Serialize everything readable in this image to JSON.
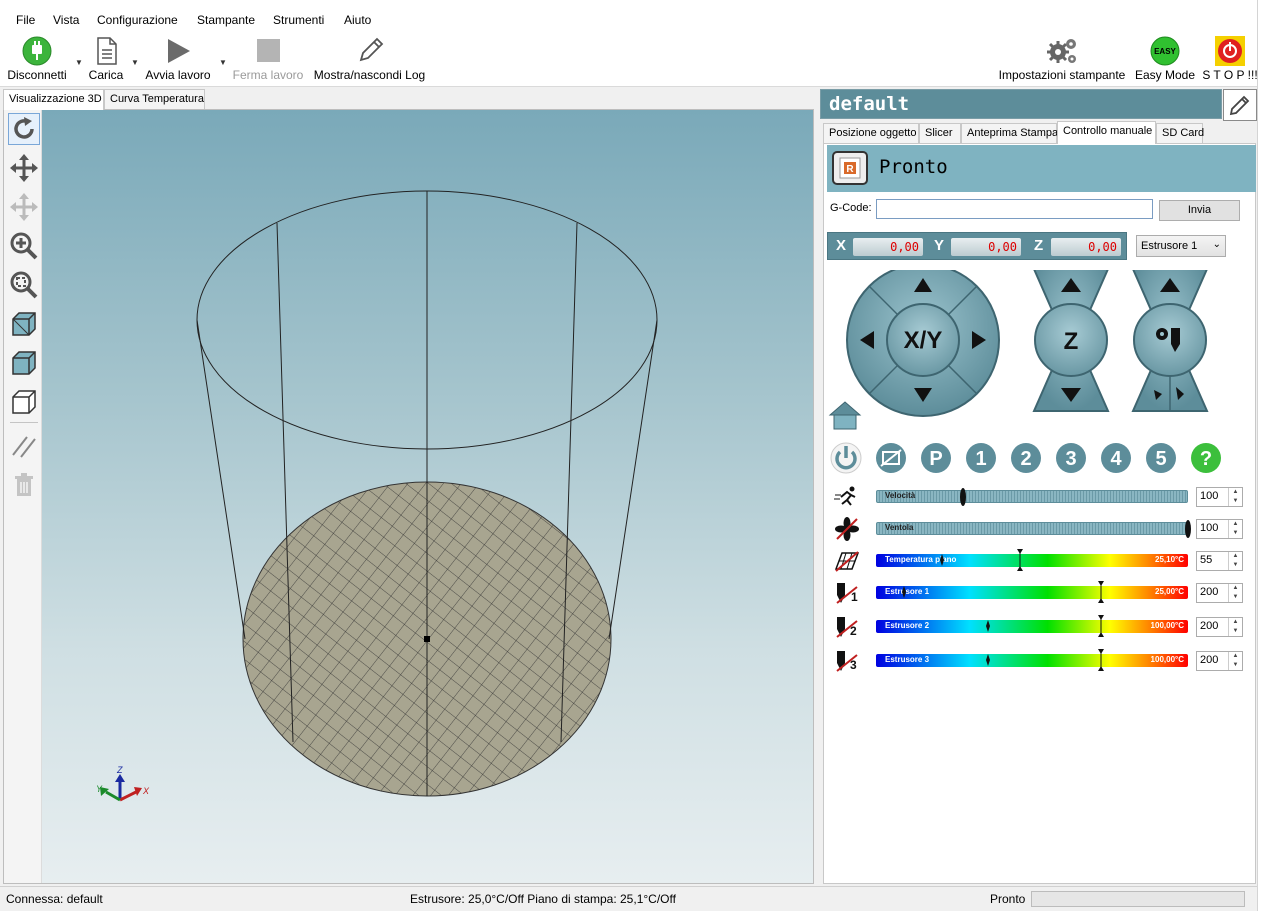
{
  "menu": {
    "items": [
      "File",
      "Vista",
      "Configurazione",
      "Stampante",
      "Strumenti",
      "Aiuto"
    ]
  },
  "toolbar": {
    "disconnect_label": "Disconnetti",
    "load_label": "Carica",
    "start_label": "Avvia lavoro",
    "stop_job_label": "Ferma lavoro",
    "log_label": "Mostra/nascondi Log",
    "printer_settings_label": "Impostazioni stampante",
    "easy_mode_label": "Easy Mode",
    "easy_badge": "EASY",
    "stop_label": "S T O P !!!"
  },
  "view_tabs": [
    "Visualizzazione 3D",
    "Curva Temperatura"
  ],
  "axes": {
    "x": "X",
    "y": "Y",
    "z": "Z"
  },
  "panel": {
    "title": "default",
    "tabs": [
      "Posizione oggetto",
      "Slicer",
      "Anteprima Stampa",
      "Controllo manuale",
      "SD Card"
    ],
    "active_tab": "Controllo manuale",
    "status": "Pronto",
    "gcode_label": "G-Code:",
    "gcode_value": "",
    "send_label": "Invia",
    "coords": {
      "x_label": "X",
      "x": "0,00",
      "y_label": "Y",
      "y": "0,00",
      "z_label": "Z",
      "z": "0,00"
    },
    "extruder_select": "Estrusore 1",
    "jog_xy": "X/Y",
    "jog_z": "Z",
    "buttons": [
      "P",
      "1",
      "2",
      "3",
      "4",
      "5",
      "?"
    ]
  },
  "sliders": [
    {
      "label": "Velocità",
      "value": "100",
      "pos": 0.28,
      "type": "plain"
    },
    {
      "label": "Ventola",
      "value": "100",
      "pos": 1.0,
      "type": "plain"
    },
    {
      "label": "Temperatura piano",
      "temp": "25,10°C",
      "value": "55",
      "pos": 0.21,
      "target": 0.46,
      "type": "temp"
    },
    {
      "label": "Estrusore 1",
      "temp": "25,00°C",
      "value": "200",
      "pos": 0.09,
      "target": 0.72,
      "type": "temp"
    },
    {
      "label": "Estrusore 2",
      "temp": "100,00°C",
      "value": "200",
      "pos": 0.36,
      "target": 0.72,
      "type": "temp"
    },
    {
      "label": "Estrusore 3",
      "temp": "100,00°C",
      "value": "200",
      "pos": 0.36,
      "target": 0.72,
      "type": "temp"
    }
  ],
  "statusbar": {
    "connection": "Connessa: default",
    "temps": "Estrusore: 25,0°C/Off Piano di stampa: 25,1°C/Off",
    "state": "Pronto"
  },
  "colors": {
    "accent": "#5d8d9a",
    "status_bg": "#7fb3c1",
    "power_green": "#3cb43c",
    "stop_red": "#e02020"
  }
}
